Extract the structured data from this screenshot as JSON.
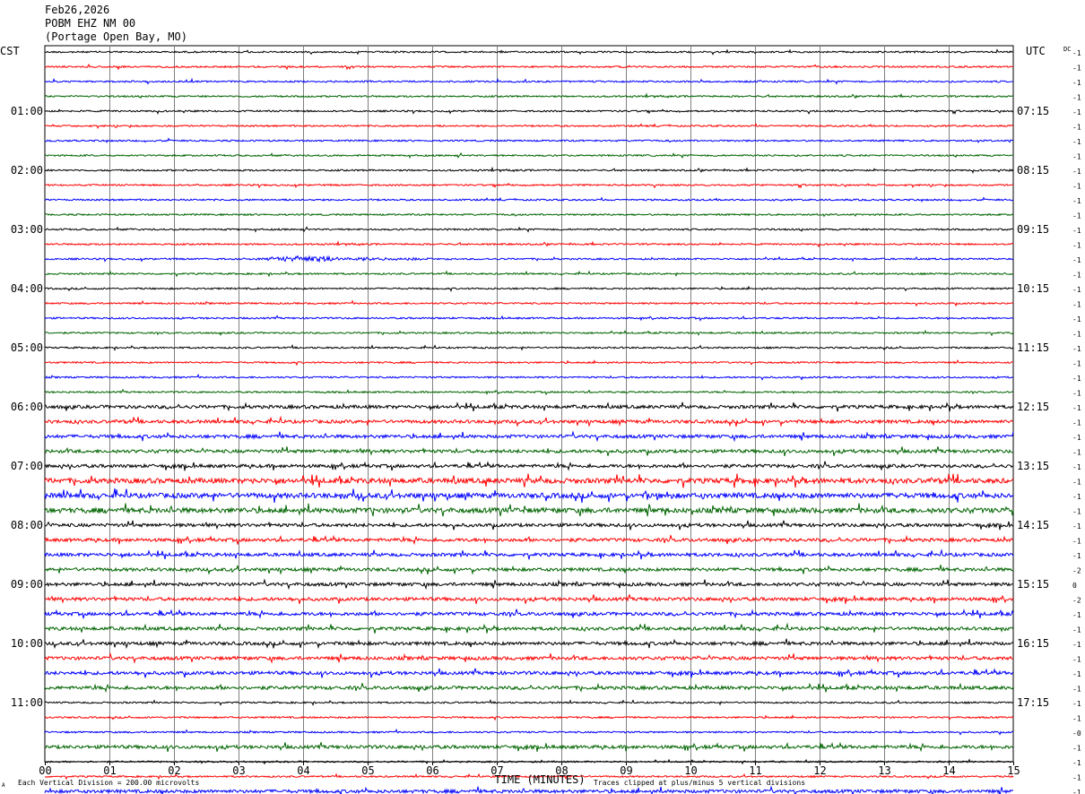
{
  "header": {
    "date": "Feb26,2026",
    "station": "POBM EHZ NM 00",
    "location": "(Portage Open Bay, MO)"
  },
  "left_axis_title": "CST",
  "right_axis_title": "UTC",
  "dc_label": "DC",
  "footer": {
    "scale": "Each Vertical Division =  200.00 microvolts",
    "clip_note": "Traces clipped at plus/minus 5 vertical divisions",
    "corner_mark": "A"
  },
  "colors": {
    "black": "#000000",
    "red": "#ff0000",
    "blue": "#0000ff",
    "green": "#006400",
    "grid": "#808080"
  },
  "chart_data": {
    "type": "line",
    "title": "",
    "xlabel": "TIME (MINUTES)",
    "ylabel": "",
    "xlim": [
      0,
      15
    ],
    "x_ticks": [
      "00",
      "01",
      "02",
      "03",
      "04",
      "05",
      "06",
      "07",
      "08",
      "09",
      "10",
      "11",
      "12",
      "13",
      "14",
      "15"
    ],
    "trace_minutes": 15,
    "trace_count": 48,
    "trace_colors": [
      "black",
      "red",
      "blue",
      "green"
    ],
    "left_hour_labels": [
      "01:00",
      "02:00",
      "03:00",
      "04:00",
      "05:00",
      "06:00",
      "07:00",
      "08:00",
      "09:00",
      "10:00",
      "11:00"
    ],
    "right_hour_labels": [
      "07:15",
      "08:15",
      "09:15",
      "10:15",
      "11:15",
      "12:15",
      "13:15",
      "14:15",
      "15:15",
      "16:15",
      "17:15"
    ],
    "dc_offsets": [
      "-1",
      "-1",
      "-1",
      "-1",
      "-1",
      "-1",
      "-1",
      "-1",
      "-1",
      "-1",
      "-1",
      "-1",
      "-1",
      "-1",
      "-1",
      "-1",
      "-1",
      "-1",
      "-1",
      "-1",
      "-1",
      "-1",
      "-1",
      "-1",
      "-1",
      "-1",
      "-1",
      "-1",
      "-1",
      "-1",
      "-1",
      "-1",
      "-1",
      "-1",
      "-1",
      "-2",
      "0",
      "-2",
      "-1",
      "-1",
      "-1",
      "-1",
      "-1",
      "-1",
      "-1",
      "-1",
      "-0",
      "-1",
      "-1",
      "-1",
      "-1",
      "-1"
    ],
    "noise_levels": [
      1,
      1,
      1,
      1,
      1,
      1,
      1,
      1,
      1,
      1,
      1,
      1,
      1,
      1,
      1,
      1,
      1,
      1,
      1,
      1,
      1,
      1,
      1,
      1,
      2,
      2,
      2,
      2,
      2,
      3,
      3,
      3,
      2,
      2,
      2,
      2,
      2,
      2,
      2,
      2,
      2,
      2,
      2,
      2,
      1,
      1,
      1,
      2,
      1,
      1,
      2,
      2
    ],
    "events": [
      {
        "trace": 14,
        "start_min": 3.0,
        "end_min": 6.5,
        "peak_min": 4.0,
        "amplitude_div": 1.5
      },
      {
        "trace": 51,
        "start_min": 5.0,
        "end_min": 5.8,
        "peak_min": 5.35,
        "amplitude_div": 5.0
      },
      {
        "trace": 51,
        "start_min": 8.4,
        "end_min": 9.6,
        "peak_min": 8.8,
        "amplitude_div": 4.0
      }
    ]
  }
}
